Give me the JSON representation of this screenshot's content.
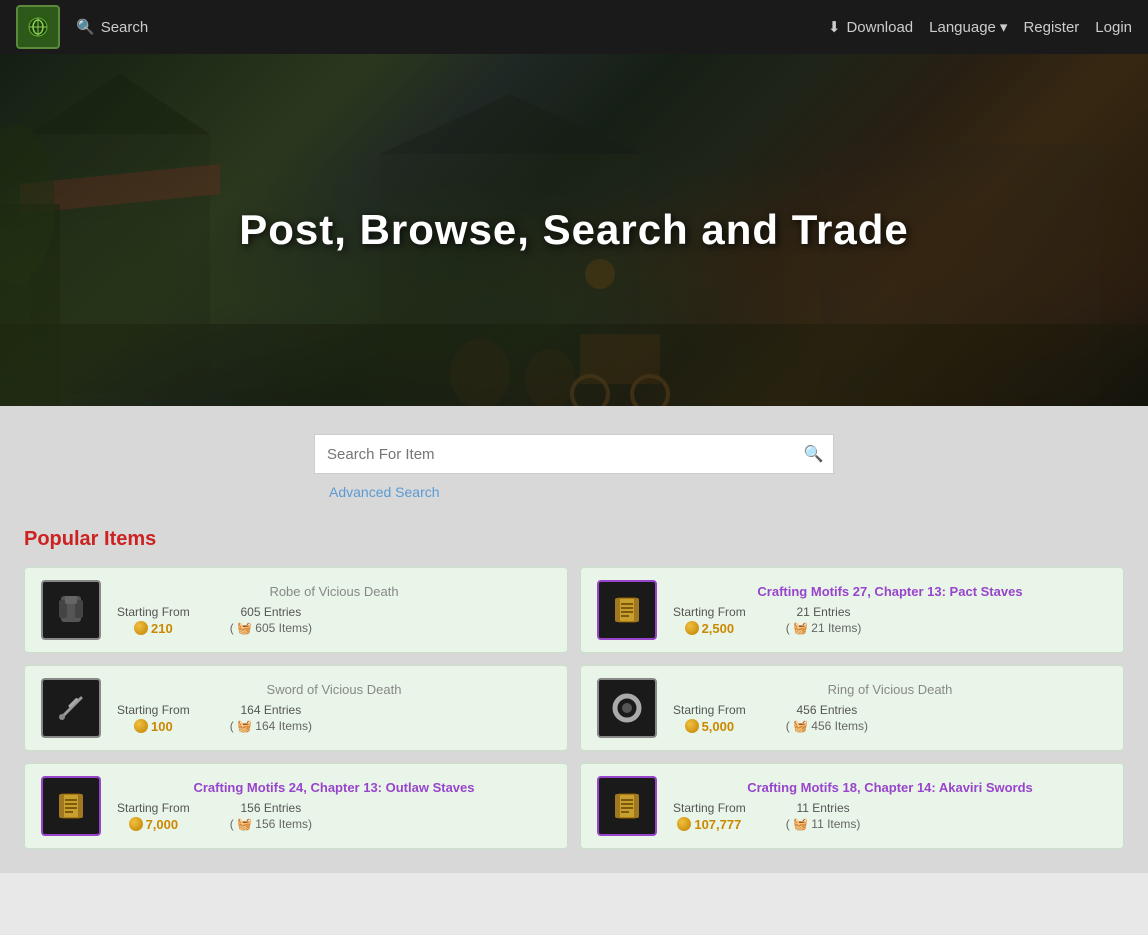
{
  "navbar": {
    "logo_symbol": "🌿",
    "search_label": "Search",
    "download_label": "Download",
    "language_label": "Language",
    "register_label": "Register",
    "login_label": "Login"
  },
  "hero": {
    "title": "Post, Browse, Search and Trade"
  },
  "search": {
    "placeholder": "Search For Item",
    "advanced_label": "Advanced Search"
  },
  "popular": {
    "title": "Popular Items",
    "items": [
      {
        "id": 1,
        "name": "Robe of Vicious Death",
        "name_color": "gray",
        "icon_type": "robe",
        "icon_border": "normal",
        "starting_from_label": "Starting From",
        "price": "210",
        "entries_count": "605 Entries",
        "items_count": "( 🧺 605 Items)"
      },
      {
        "id": 2,
        "name": "Crafting Motifs 27, Chapter 13: Pact Staves",
        "name_color": "purple",
        "icon_type": "scroll",
        "icon_border": "purple",
        "starting_from_label": "Starting From",
        "price": "2,500",
        "entries_count": "21 Entries",
        "items_count": "( 🧺 21 Items)"
      },
      {
        "id": 3,
        "name": "Sword of Vicious Death",
        "name_color": "gray",
        "icon_type": "sword",
        "icon_border": "normal",
        "starting_from_label": "Starting From",
        "price": "100",
        "entries_count": "164 Entries",
        "items_count": "( 🧺 164 Items)"
      },
      {
        "id": 4,
        "name": "Ring of Vicious Death",
        "name_color": "gray",
        "icon_type": "ring",
        "icon_border": "normal",
        "starting_from_label": "Starting From",
        "price": "5,000",
        "entries_count": "456 Entries",
        "items_count": "( 🧺 456 Items)"
      },
      {
        "id": 5,
        "name": "Crafting Motifs 24, Chapter 13: Outlaw Staves",
        "name_color": "purple",
        "icon_type": "scroll",
        "icon_border": "purple",
        "starting_from_label": "Starting From",
        "price": "7,000",
        "entries_count": "156 Entries",
        "items_count": "( 🧺 156 Items)"
      },
      {
        "id": 6,
        "name": "Crafting Motifs 18, Chapter 14: Akaviri Swords",
        "name_color": "purple",
        "icon_type": "scroll",
        "icon_border": "purple",
        "starting_from_label": "Starting From",
        "price": "107,777",
        "entries_count": "11 Entries",
        "items_count": "( 🧺 11 Items)"
      }
    ]
  }
}
